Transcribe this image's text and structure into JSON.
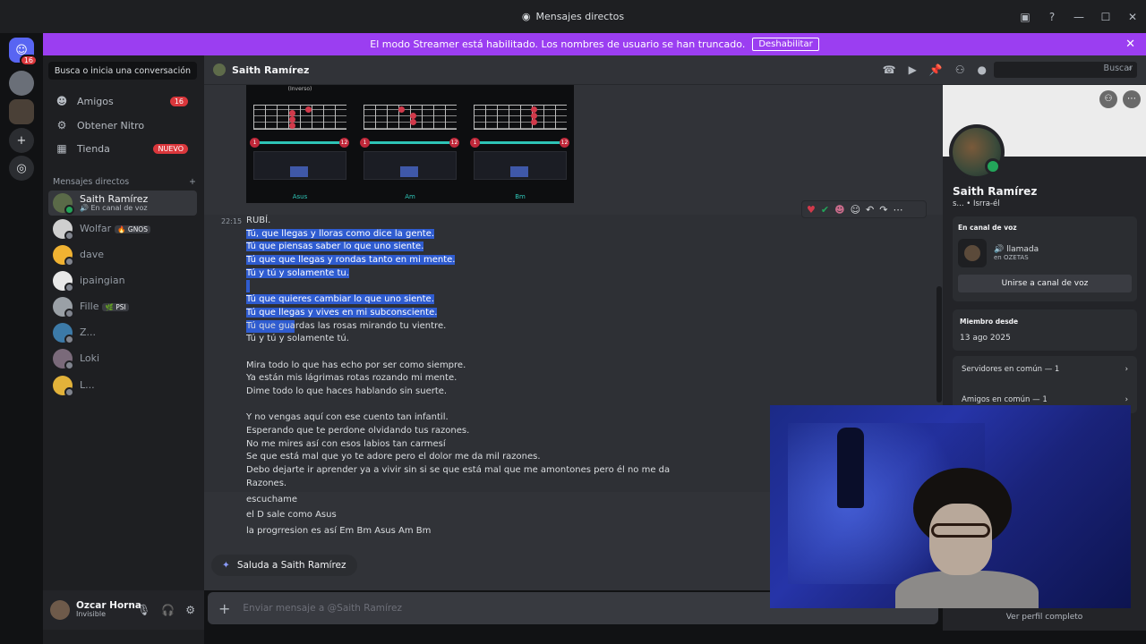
{
  "window": {
    "title": "Mensajes directos",
    "controls": [
      "—",
      "☐",
      "✕"
    ]
  },
  "banner": {
    "text": "El modo Streamer está habilitado. Los nombres de usuario se han truncado.",
    "button": "Deshabilitar"
  },
  "rail": {
    "home_badge": "16"
  },
  "sidebar": {
    "search": "Busca o inicia una conversación",
    "nav": [
      {
        "label": "Amigos",
        "badge": "16",
        "icon": "friends-icon"
      },
      {
        "label": "Obtener Nitro",
        "badge": "",
        "icon": "nitro-icon"
      },
      {
        "label": "Tienda",
        "badge": "NUEVO",
        "icon": "shop-icon"
      }
    ],
    "dm_header": "Mensajes directos",
    "dms": [
      {
        "name": "Saith Ramírez",
        "sub": "🔊 En canal de voz",
        "tag": "",
        "color": "#5a6a48"
      },
      {
        "name": "Wolfar",
        "sub": "",
        "tag": "🔥 GNOS",
        "color": "#cfcfcf"
      },
      {
        "name": "dave",
        "sub": "",
        "tag": "",
        "color": "#f0b232"
      },
      {
        "name": "ipaingian",
        "sub": "",
        "tag": "",
        "color": "#e8e8e8"
      },
      {
        "name": "Fille",
        "sub": "",
        "tag": "🌿 PSI",
        "color": "#9aa0a6"
      },
      {
        "name": "Z...",
        "sub": "",
        "tag": "",
        "color": "#3c7aa8"
      },
      {
        "name": "Loki",
        "sub": "",
        "tag": "",
        "color": "#7a6a7a"
      },
      {
        "name": "L...",
        "sub": "",
        "tag": "",
        "color": "#e2b23a"
      }
    ]
  },
  "user": {
    "name": "Ozcar Horna",
    "status": "Invisible"
  },
  "chat_header": {
    "name": "Saith Ramírez",
    "search_placeholder": "Buscar"
  },
  "chords": [
    {
      "label": "Asus",
      "note": "(Inverso)",
      "start": "1",
      "end": "12"
    },
    {
      "label": "Am",
      "note": "",
      "start": "1",
      "end": "12"
    },
    {
      "label": "Bm",
      "note": "",
      "start": "1",
      "end": "12"
    }
  ],
  "message": {
    "time": "22:15",
    "lines": [
      "RUBÍ.",
      "Tú, que llegas y lloras como dice la gente.",
      "Tú que piensas saber lo que uno siente.",
      "Tú que que llegas y rondas tanto en mi mente.",
      "Tú y tú y solamente tu.",
      "",
      "Tú que quieres cambiar lo que uno siente.",
      "Tú que llegas y vives en mi subconsciente.",
      "Tú que guardas las rosas mirando tu vientre.",
      "Tú y tú y solamente tú.",
      "",
      "Mira todo lo que has echo por ser como siempre.",
      "Ya están mis lágrimas rotas rozando mi mente.",
      "Dime todo lo que haces hablando sin suerte.",
      "",
      "Y no vengas aquí con ese cuento tan infantil.",
      "Esperando que te perdone olvidando tus razones.",
      "No me mires así con esos labios tan carmesí",
      "Se que está mal que yo te adore pero el dolor me da mil razones.",
      "Debo dejarte ir aprender ya a vivir sin si se que está mal que me amontones pero él no me da",
      "Razones."
    ],
    "follow": [
      "escuchame",
      "el D sale como Asus",
      "la progrresion es así Em Bm Asus Am Bm"
    ]
  },
  "wave": "Saluda a Saith Ramírez",
  "composer": {
    "placeholder": "Enviar mensaje a @Saith Ramírez"
  },
  "profile": {
    "name": "Saith Ramírez",
    "sub": "s... • Isrra-él",
    "voice_header": "En canal de voz",
    "channel": "🔊 llamada",
    "channel_sub": "en OZETAS",
    "join": "Unirse a canal de voz",
    "member_header": "Miembro desde",
    "member_date": "13 ago 2025",
    "servers": "Servidores en común — 1",
    "friends": "Amigos en común — 1",
    "view_full": "Ver perfil completo"
  }
}
